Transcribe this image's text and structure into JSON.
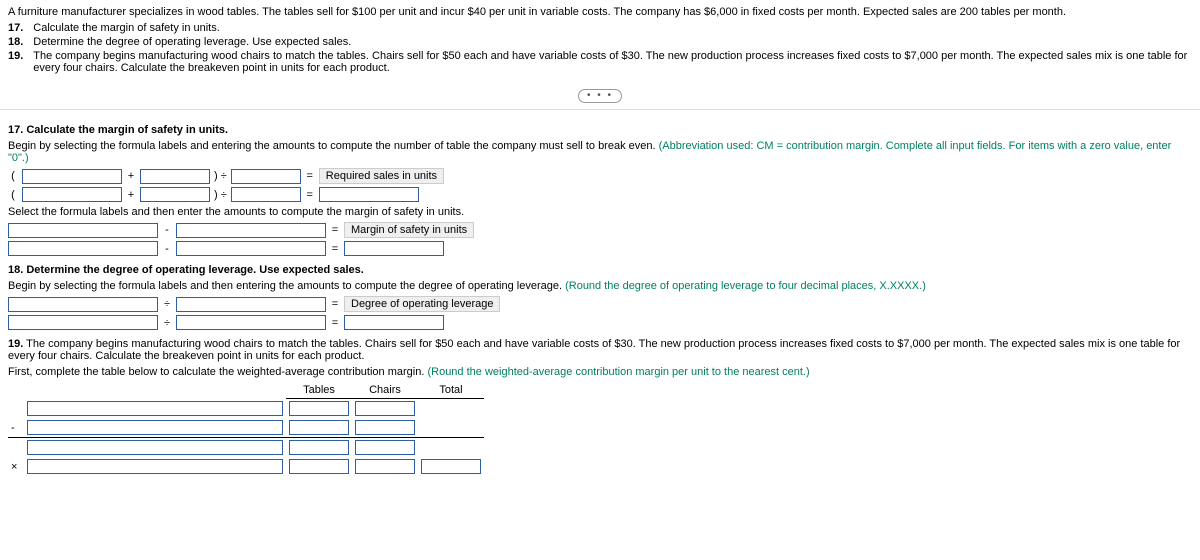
{
  "intro": "A furniture manufacturer specializes in wood tables. The tables sell for $100 per unit and incur $40 per unit in variable costs. The company has $6,000 in fixed costs per month. Expected sales are 200 tables per month.",
  "questions": [
    {
      "num": "17.",
      "text": "Calculate the margin of safety in units."
    },
    {
      "num": "18.",
      "text": "Determine the degree of operating leverage. Use expected sales."
    },
    {
      "num": "19.",
      "text": "The company begins manufacturing wood chairs to match the tables. Chairs sell for $50 each and have variable costs of $30. The new production process increases fixed costs to $7,000 per month. The expected sales mix is one table for every four chairs. Calculate the breakeven point in units for each product."
    }
  ],
  "dots": "• • •",
  "s17": {
    "head_num": "17.",
    "head_text": "Calculate the margin of safety in units.",
    "instr": "Begin by selecting the formula labels and entering the amounts to compute the number of table the company must sell to break even.",
    "hint": "(Abbreviation used: CM = contribution margin. Complete all input fields. For items with a zero value, enter \"0\".)",
    "lparen": "(",
    "plus": "+",
    "rpdiv": ") ÷",
    "eq": "=",
    "result_label": "Required sales in units",
    "instr2": "Select the formula labels and then enter the amounts to compute the margin of safety in units.",
    "minus": "-",
    "result_label2": "Margin of safety in units"
  },
  "s18": {
    "head_num": "18.",
    "head_text": "Determine the degree of operating leverage. Use expected sales.",
    "instr": "Begin by selecting the formula labels and then entering the amounts to compute the degree of operating leverage.",
    "hint": "(Round the degree of operating leverage to four decimal places, X.XXXX.)",
    "div": "÷",
    "eq": "=",
    "result_label": "Degree of operating leverage"
  },
  "s19": {
    "head_num": "19.",
    "head_text": "The company begins manufacturing wood chairs to match the tables. Chairs sell for $50 each and have variable costs of $30. The new production process increases fixed costs to $7,000 per month. The expected sales mix is one table for every four chairs. Calculate the breakeven point in units for each product.",
    "instr": "First, complete the table below to calculate the weighted-average contribution margin.",
    "hint": "(Round the weighted-average contribution margin per unit to the nearest cent.)",
    "col_tables": "Tables",
    "col_chairs": "Chairs",
    "col_total": "Total",
    "minus": "-",
    "times": "×"
  }
}
